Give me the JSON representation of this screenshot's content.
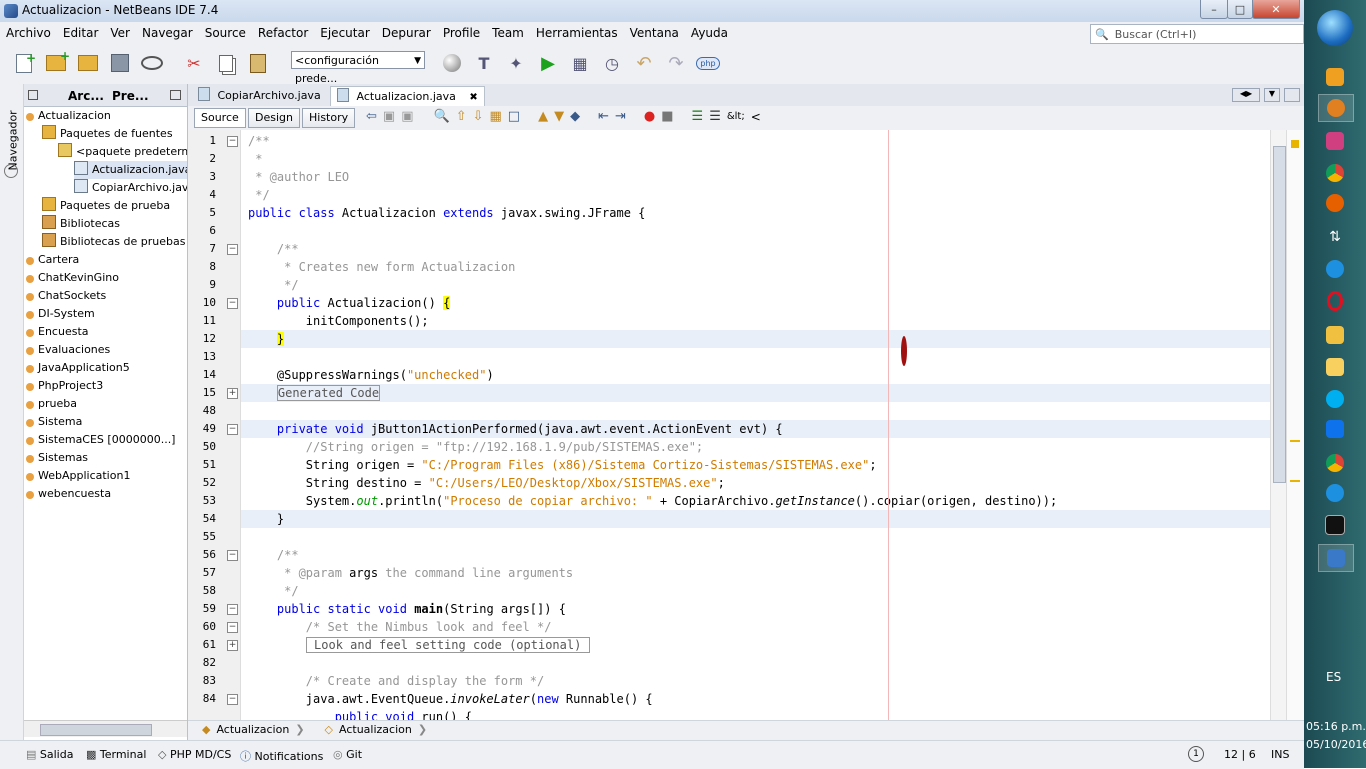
{
  "window": {
    "title": "Actualizacion - NetBeans IDE 7.4"
  },
  "menu": [
    "Archivo",
    "Editar",
    "Ver",
    "Navegar",
    "Source",
    "Refactor",
    "Ejecutar",
    "Depurar",
    "Profile",
    "Team",
    "Herramientas",
    "Ventana",
    "Ayuda"
  ],
  "search": {
    "placeholder": "Buscar (Ctrl+I)"
  },
  "toolbar": {
    "config": "<configuración prede...",
    "php": "php"
  },
  "leftstrip": {
    "navigator": "Navegador"
  },
  "project_tabs": [
    "Arc...",
    "Pre..."
  ],
  "tree": [
    {
      "label": "Actualizacion",
      "indent": 0,
      "icon": "project-icon"
    },
    {
      "label": "Paquetes de fuentes",
      "indent": 1,
      "icon": "folder-icon"
    },
    {
      "label": "<paquete predetermin",
      "indent": 2,
      "icon": "package-icon"
    },
    {
      "label": "Actualizacion.java",
      "indent": 3,
      "icon": "java-file-icon",
      "selected": true
    },
    {
      "label": "CopiarArchivo.java",
      "indent": 3,
      "icon": "java-file-icon"
    },
    {
      "label": "Paquetes de prueba",
      "indent": 1,
      "icon": "folder-icon"
    },
    {
      "label": "Bibliotecas",
      "indent": 1,
      "icon": "library-icon"
    },
    {
      "label": "Bibliotecas de pruebas",
      "indent": 1,
      "icon": "library-icon"
    },
    {
      "label": "Cartera",
      "indent": 0,
      "icon": "project-icon"
    },
    {
      "label": "ChatKevinGino",
      "indent": 0,
      "icon": "project-icon"
    },
    {
      "label": "ChatSockets",
      "indent": 0,
      "icon": "project-icon"
    },
    {
      "label": "DI-System",
      "indent": 0,
      "icon": "project-icon"
    },
    {
      "label": "Encuesta",
      "indent": 0,
      "icon": "project-icon"
    },
    {
      "label": "Evaluaciones",
      "indent": 0,
      "icon": "project-icon"
    },
    {
      "label": "JavaApplication5",
      "indent": 0,
      "icon": "project-icon"
    },
    {
      "label": "PhpProject3",
      "indent": 0,
      "icon": "project-icon"
    },
    {
      "label": "prueba",
      "indent": 0,
      "icon": "project-icon"
    },
    {
      "label": "Sistema",
      "indent": 0,
      "icon": "project-icon"
    },
    {
      "label": "SistemaCES [0000000...]",
      "indent": 0,
      "icon": "project-icon"
    },
    {
      "label": "Sistemas",
      "indent": 0,
      "icon": "project-icon"
    },
    {
      "label": "WebApplication1",
      "indent": 0,
      "icon": "project-icon"
    },
    {
      "label": "webencuesta",
      "indent": 0,
      "icon": "project-icon"
    }
  ],
  "editor_tabs": [
    "CopiarArchivo.java",
    "Actualizacion.java"
  ],
  "view_tabs": [
    "Source",
    "Design",
    "History"
  ],
  "editor_toolbar": {
    "lt": "&lt;",
    "lt2": "<"
  },
  "code_lines": [
    {
      "n": "1",
      "fold": "-",
      "html": "<span class='cm'>/**</span>"
    },
    {
      "n": "2",
      "html": "<span class='cm'> *</span>"
    },
    {
      "n": "3",
      "html": "<span class='cm'> * @author LEO</span>"
    },
    {
      "n": "4",
      "html": "<span class='cm'> */</span>"
    },
    {
      "n": "5",
      "html": "<span class='kw'>public class</span> Actualizacion <span class='kw'>extends</span> javax.swing.JFrame {"
    },
    {
      "n": "6",
      "html": ""
    },
    {
      "n": "7",
      "fold": "-",
      "html": "    <span class='cm'>/**</span>"
    },
    {
      "n": "8",
      "html": "<span class='cm'>     * Creates new form Actualizacion</span>"
    },
    {
      "n": "9",
      "html": "<span class='cm'>     */</span>"
    },
    {
      "n": "10",
      "fold": "-",
      "html": "    <span class='kw'>public</span> Actualizacion() <span style='background:#ffff00'>{</span>"
    },
    {
      "n": "11",
      "html": "        initComponents();"
    },
    {
      "n": "12",
      "hl": true,
      "html": "    <span style='background:#ffff00'>}</span>"
    },
    {
      "n": "13",
      "html": ""
    },
    {
      "n": "14",
      "html": "    @SuppressWarnings(<span class='str'>\"unchecked\"</span>)"
    },
    {
      "n": "15",
      "fold": "+",
      "hl": true,
      "html": "    <span style='border:1px solid #999;color:#555'>Generated Code</span>"
    },
    {
      "n": "48",
      "html": ""
    },
    {
      "n": "49",
      "fold": "-",
      "hl": true,
      "html": "    <span class='kw'>private void</span> jButton1ActionPerformed(java.awt.event.ActionEvent evt) {"
    },
    {
      "n": "50",
      "html": "        <span class='cm'>//String origen = \"ftp://192.168.1.9/pub/SISTEMAS.exe\";</span>"
    },
    {
      "n": "51",
      "html": "        String origen = <span class='str'>\"C:/Program Files (x86)/Sistema Cortizo-Sistemas/SISTEMAS.exe\"</span>;"
    },
    {
      "n": "52",
      "html": "        String destino = <span class='str'>\"C:/Users/LEO/Desktop/Xbox/SISTEMAS.exe\"</span>;"
    },
    {
      "n": "53",
      "html": "        System.<span class='it' style='color:#009900'>out</span>.println(<span class='str'>\"Proceso de copiar archivo: \"</span> + CopiarArchivo.<span class='it'>getInstance</span>().copiar(origen, destino));"
    },
    {
      "n": "54",
      "hl": true,
      "html": "    }"
    },
    {
      "n": "55",
      "html": ""
    },
    {
      "n": "56",
      "fold": "-",
      "html": "    <span class='cm'>/**</span>"
    },
    {
      "n": "57",
      "html": "<span class='cm'>     * @param </span>args<span class='cm'> the command line arguments</span>"
    },
    {
      "n": "58",
      "html": "<span class='cm'>     */</span>"
    },
    {
      "n": "59",
      "fold": "-",
      "html": "    <span class='kw'>public static void</span> <b>main</b>(String args[]) {"
    },
    {
      "n": "60",
      "fold": "-",
      "html": "        <span class='cm'>/* Set the Nimbus look and feel */</span>"
    },
    {
      "n": "61",
      "fold": "+",
      "html": "        <span style='border:1px solid #999;color:#555'> Look and feel setting code (optional) </span>"
    },
    {
      "n": "82",
      "html": ""
    },
    {
      "n": "83",
      "html": "        <span class='cm'>/* Create and display the form */</span>"
    },
    {
      "n": "84",
      "fold": "-",
      "html": "        java.awt.EventQueue.<span class='it'>invokeLater</span>(<span class='kw'>new</span> Runnable() {"
    },
    {
      "n": "",
      "html": "            <span class='kw'>public void</span> run() {"
    }
  ],
  "breadcrumbs": [
    "Actualizacion",
    "Actualizacion"
  ],
  "status": {
    "items": [
      "Salida",
      "Terminal",
      "PHP MD/CS",
      "Notifications",
      "Git"
    ],
    "position": "12 | 6",
    "mode": "INS"
  },
  "taskbar": {
    "lang": "ES",
    "time": "05:16 p.m.",
    "date": "05/10/2016"
  }
}
